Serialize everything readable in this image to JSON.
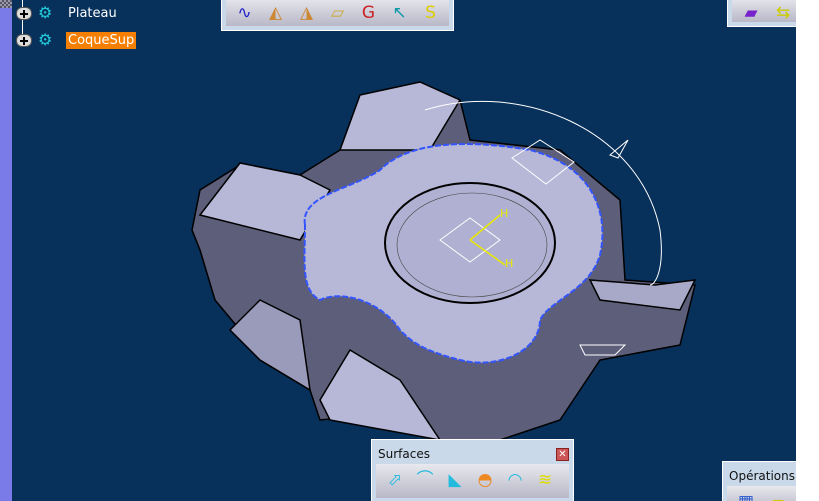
{
  "tree": {
    "items": [
      {
        "label": "Plateau",
        "selected": false
      },
      {
        "label": "CoqueSup",
        "selected": true
      }
    ]
  },
  "toolbars": {
    "top_center": {
      "icons": [
        "spline-icon",
        "sketch-profile-icon",
        "sketch-profile-2-icon",
        "planar-sketch-icon",
        "circle-point-icon",
        "corner-icon",
        "connect-curve-icon"
      ]
    },
    "top_right": {
      "icons": [
        "pad-icon",
        "move-icon"
      ]
    },
    "surfaces": {
      "title": "Surfaces",
      "icons": [
        "extrude-surface-icon",
        "revolve-surface-icon",
        "offset-surface-icon",
        "fill-icon",
        "sweep-icon",
        "multi-section-surface-icon"
      ]
    },
    "operations": {
      "title": "Opérations",
      "icons": [
        "join-icon",
        "split-icon"
      ]
    }
  },
  "colors": {
    "background": "#07305a",
    "selection": "#f57f00",
    "part": "#b7b7d8"
  },
  "axis": {
    "h_label_1": "H",
    "h_label_2": "H"
  }
}
